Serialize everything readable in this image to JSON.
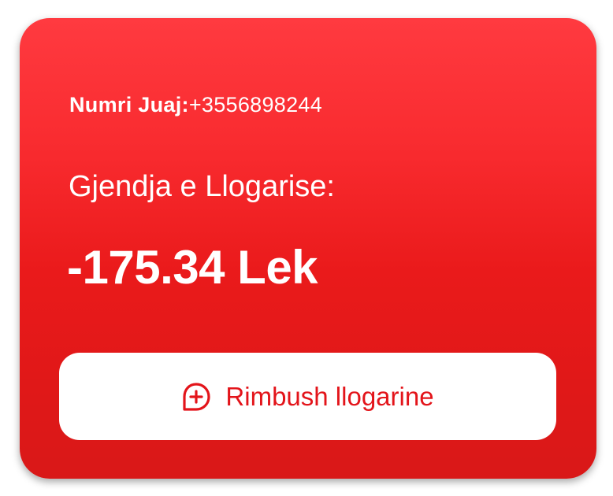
{
  "account": {
    "number_label": "Numri Juaj:",
    "number_value": "+3556898244",
    "balance_label": "Gjendja e Llogarise:",
    "balance_value": "-175.34 Lek"
  },
  "actions": {
    "topup_label": "Rimbush llogarine",
    "topup_icon": "chat-plus-icon"
  },
  "colors": {
    "card_top": "#ff3a40",
    "card_bottom": "#d91818",
    "accent": "#e3141a",
    "button_bg": "#ffffff",
    "text": "#ffffff"
  }
}
